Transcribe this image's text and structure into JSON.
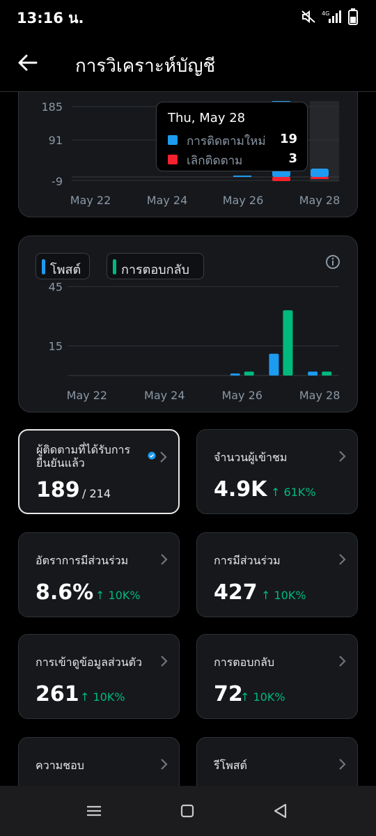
{
  "status": {
    "time": "13:16 น."
  },
  "header": {
    "title": "การวิเคราะห์บัญชี"
  },
  "followers_chart": {
    "yticks": [
      "185",
      "91",
      "-9"
    ],
    "xticks": [
      "May 22",
      "May 24",
      "May 26",
      "May 28"
    ],
    "tooltip": {
      "date": "Thu, May 28",
      "rows": [
        {
          "label": "การติดตามใหม่",
          "value": "19",
          "color": "#1d9bf0"
        },
        {
          "label": "เลิกติดตาม",
          "value": "3",
          "color": "#f4212e"
        }
      ]
    }
  },
  "chart_data": {
    "type": "bar",
    "categories": [
      "May 22",
      "May 23",
      "May 24",
      "May 25",
      "May 26",
      "May 27",
      "May 28"
    ],
    "series": [
      {
        "name": "โพสต์",
        "values": [
          0,
          0,
          0,
          0,
          1,
          11,
          2
        ]
      },
      {
        "name": "การตอบกลับ",
        "values": [
          0,
          0,
          0,
          0,
          2,
          33,
          2
        ]
      }
    ],
    "ylim": [
      0,
      55
    ],
    "yticks": [
      "45",
      "15"
    ],
    "xticks": [
      "May 22",
      "May 24",
      "May 26",
      "May 28"
    ],
    "legend_position": "top-left",
    "colors": [
      "#1d9bf0",
      "#00ba7c"
    ]
  },
  "stats": [
    {
      "label": "ผู้ติดตามที่ได้รับการยืนยันแล้ว",
      "value": "189",
      "extra": "/ 214",
      "change": ""
    },
    {
      "label": "จำนวนผู้เข้าชม",
      "value": "4.9K",
      "extra": "",
      "change": "↑ 61K%"
    },
    {
      "label": "อัตราการมีส่วนร่วม",
      "value": "8.6%",
      "extra": "",
      "change": "↑ 10K%"
    },
    {
      "label": "การมีส่วนร่วม",
      "value": "427",
      "extra": "",
      "change": "↑ 10K%"
    },
    {
      "label": "การเข้าดูข้อมูลส่วนตัว",
      "value": "261",
      "extra": "",
      "change": "↑ 10K%"
    },
    {
      "label": "การตอบกลับ",
      "value": "72",
      "extra": "",
      "change": "↑ 10K%"
    },
    {
      "label": "ความชอบ",
      "value": "",
      "extra": "",
      "change": ""
    },
    {
      "label": "รีโพสต์",
      "value": "",
      "extra": "",
      "change": ""
    }
  ],
  "icons": {
    "back": "arrow-left-icon",
    "info": "info-icon",
    "chevron": "chevron-right-icon",
    "verified": "verified-badge-icon",
    "nav": [
      "menu-icon",
      "home-square-icon",
      "back-triangle-icon"
    ]
  },
  "colors": {
    "accent": "#1d9bf0",
    "positive": "#00ba7c",
    "negative": "#f4212e",
    "background": "#000000",
    "card": "#16181c"
  }
}
